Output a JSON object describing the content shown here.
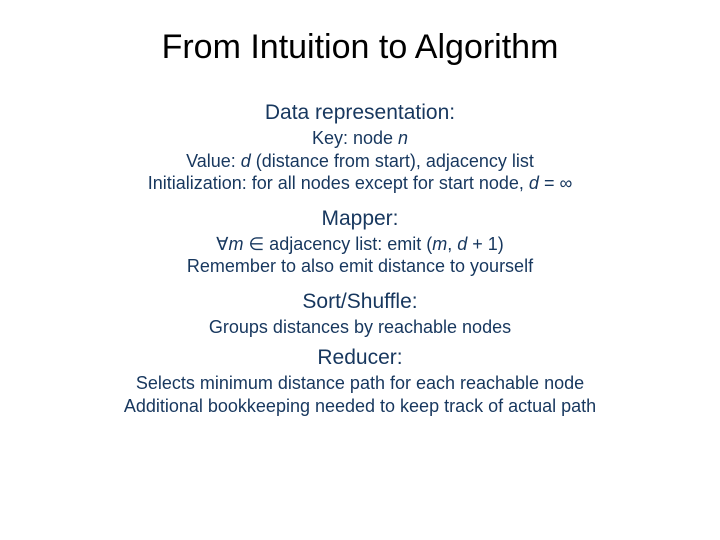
{
  "title": "From Intuition to Algorithm",
  "sections": {
    "data": {
      "heading": "Data representation:",
      "key_prefix": "Key: node ",
      "key_var": "n",
      "value_prefix": "Value: ",
      "value_var": "d",
      "value_rest": " (distance from start), adjacency list",
      "init_prefix": "Initialization: for all nodes except for start node, ",
      "init_var": "d",
      "init_eq": " = ",
      "init_inf": "∞"
    },
    "mapper": {
      "heading": "Mapper:",
      "forall": "∀",
      "var_m": "m",
      "in": " ∈ adjacency list: emit (",
      "var_m2": "m",
      "comma": ", ",
      "var_d": "d",
      "plus1": " + 1)",
      "line2": "Remember to also emit distance to yourself"
    },
    "sort": {
      "heading": "Sort/Shuffle:",
      "line1": "Groups distances by reachable nodes"
    },
    "reducer": {
      "heading": "Reducer:",
      "line1": "Selects minimum distance path for each reachable node",
      "line2": "Additional bookkeeping needed to keep track of actual path"
    }
  }
}
